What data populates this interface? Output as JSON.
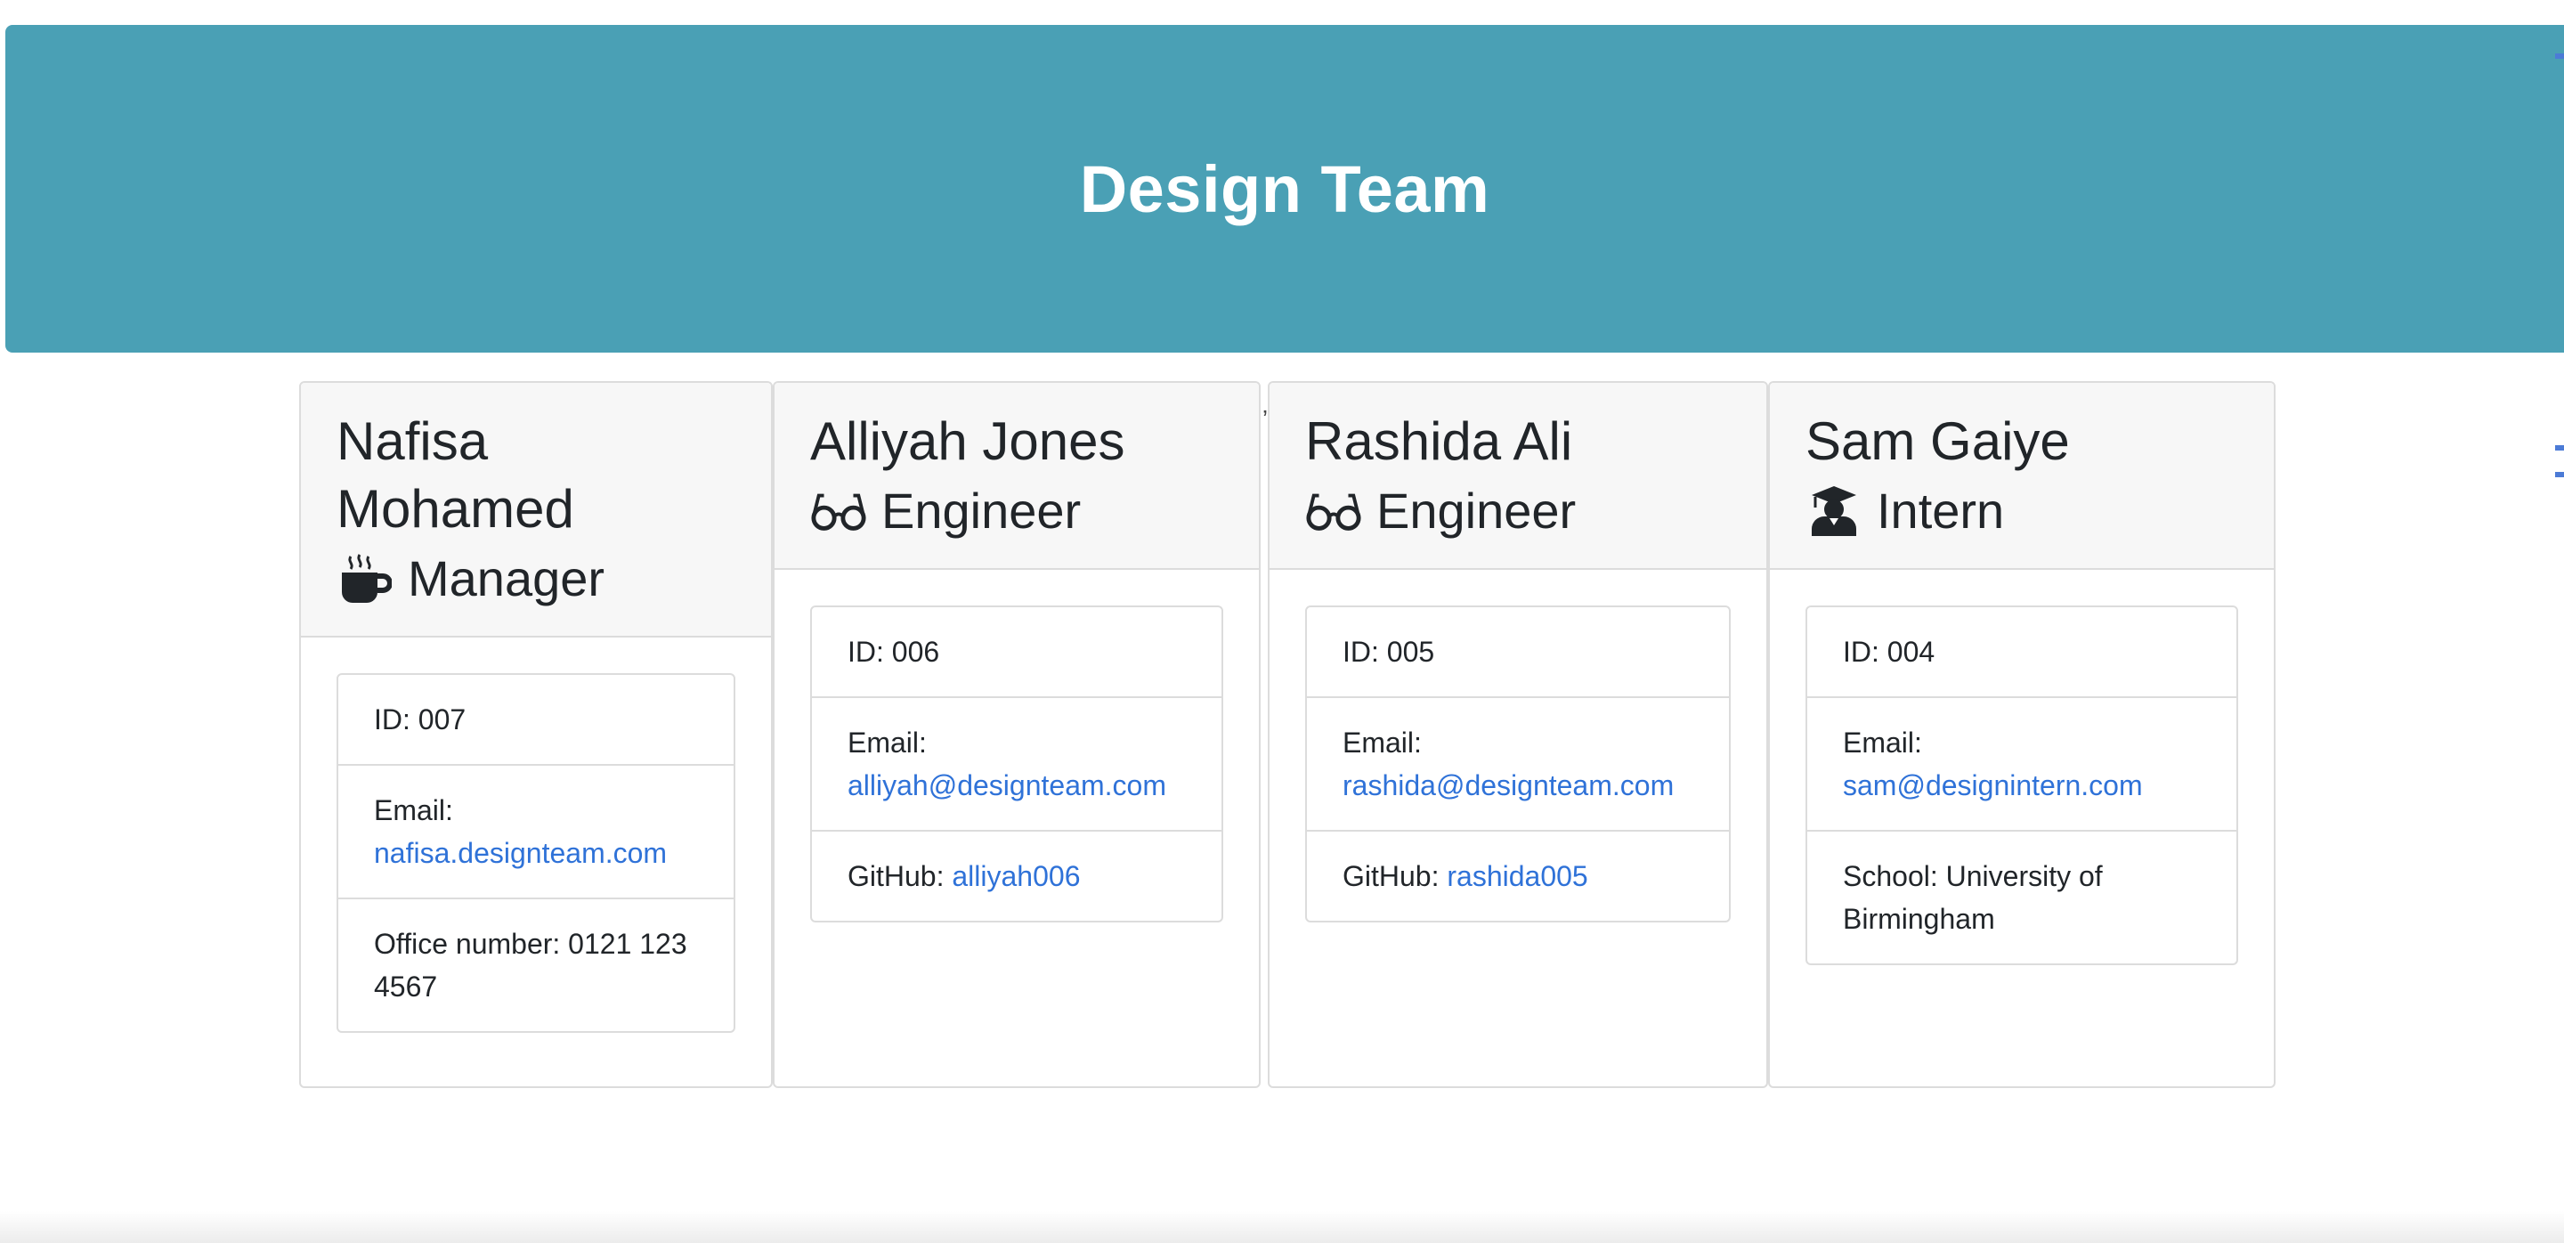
{
  "header": {
    "title": "Design Team"
  },
  "team": [
    {
      "name": "Nafisa Mohamed",
      "role": "Manager",
      "role_icon": "coffee-icon",
      "id_text": "ID: 007",
      "email_label": "Email:",
      "email": "nafisa.designteam.com",
      "extra_label": "Office number: 0121 123 4567",
      "extra_link": ""
    },
    {
      "name": "Alliyah Jones",
      "role": "Engineer",
      "role_icon": "glasses-icon",
      "id_text": "ID: 006",
      "email_label": "Email:",
      "email": "alliyah@designteam.com",
      "extra_label": "GitHub:",
      "extra_link": "alliyah006"
    },
    {
      "name": "Rashida Ali",
      "role": "Engineer",
      "role_icon": "glasses-icon",
      "id_text": "ID: 005",
      "email_label": "Email:",
      "email": "rashida@designteam.com",
      "extra_label": "GitHub:",
      "extra_link": "rashida005"
    },
    {
      "name": "Sam Gaiye",
      "role": "Intern",
      "role_icon": "graduate-icon",
      "id_text": "ID: 004",
      "email_label": "Email:",
      "email": "sam@designintern.com",
      "extra_label": "School: University of Birmingham",
      "extra_link": ""
    }
  ],
  "colors": {
    "header_bg": "#4aa0b5",
    "link": "#2f72d8"
  }
}
